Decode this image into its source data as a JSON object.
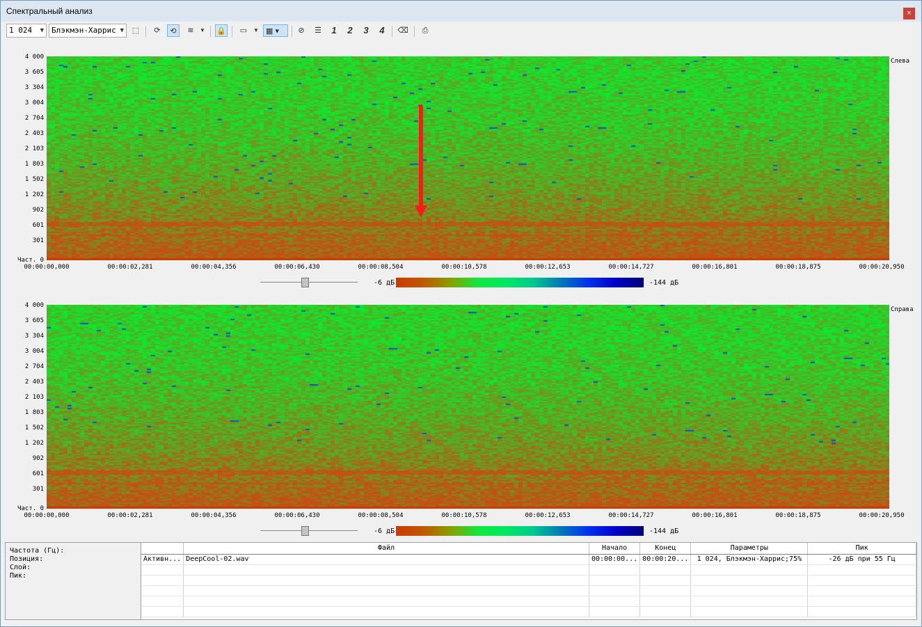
{
  "window": {
    "title": "Спектральный анализ",
    "close_glyph": "×"
  },
  "toolbar": {
    "fft_size": "1 024",
    "window_fn": "Блэкмэн-Харрис",
    "buttons": [
      {
        "name": "select-tool-icon",
        "glyph": "⬚"
      },
      {
        "name": "refresh-icon",
        "glyph": "⟳"
      },
      {
        "name": "auto-refresh-icon",
        "glyph": "⟲"
      },
      {
        "name": "analysis-mode-icon",
        "glyph": "≋"
      },
      {
        "name": "lock-icon",
        "glyph": "🔒"
      },
      {
        "name": "view-mode-icon",
        "glyph": "▭"
      },
      {
        "name": "color-scheme-icon",
        "glyph": "▦"
      },
      {
        "name": "clear-icon",
        "glyph": "⊘"
      },
      {
        "name": "list-icon",
        "glyph": "☰"
      },
      {
        "name": "eraser-icon",
        "glyph": "⌫"
      },
      {
        "name": "print-icon",
        "glyph": "⎙"
      }
    ],
    "layer_buttons": [
      "1",
      "2",
      "3",
      "4"
    ]
  },
  "y_ticks": [
    "4 000",
    "3 605",
    "3 304",
    "3 004",
    "2 704",
    "2 403",
    "2 103",
    "1 803",
    "1 502",
    "1 202",
    "902",
    "601",
    "301",
    "Част. 0"
  ],
  "x_ticks": [
    "00:00:00,000",
    "00:00:02,281",
    "00:00:04,356",
    "00:00:06,430",
    "00:00:08,504",
    "00:00:10,578",
    "00:00:12,653",
    "00:00:14,727",
    "00:00:16,801",
    "00:00:18,875",
    "00:00:20,950"
  ],
  "channels": {
    "left": "Слева",
    "right": "Справа"
  },
  "scale": {
    "high": "-6 дБ",
    "low": "-144 дБ",
    "slider_top": 0.42,
    "slider_bottom": 0.42
  },
  "colors": {
    "spectrum_green": "#10e030",
    "spectrum_low": "#c84800",
    "annotation": "#ff0000"
  },
  "info": {
    "freq": "Частота (Гц):",
    "pos": "Позиция:",
    "layer": "Слой:",
    "peak": "Пик:"
  },
  "table": {
    "headers": [
      "",
      "Файл",
      "Начало",
      "Конец",
      "Параметры",
      "Пик"
    ],
    "row": [
      "Активн...",
      "DeepCool-02.wav",
      "00:00:00...",
      "00:00:20...",
      "1 024, Блэкмэн-Харрис;75%",
      "-26 дБ при 55 Гц"
    ]
  }
}
